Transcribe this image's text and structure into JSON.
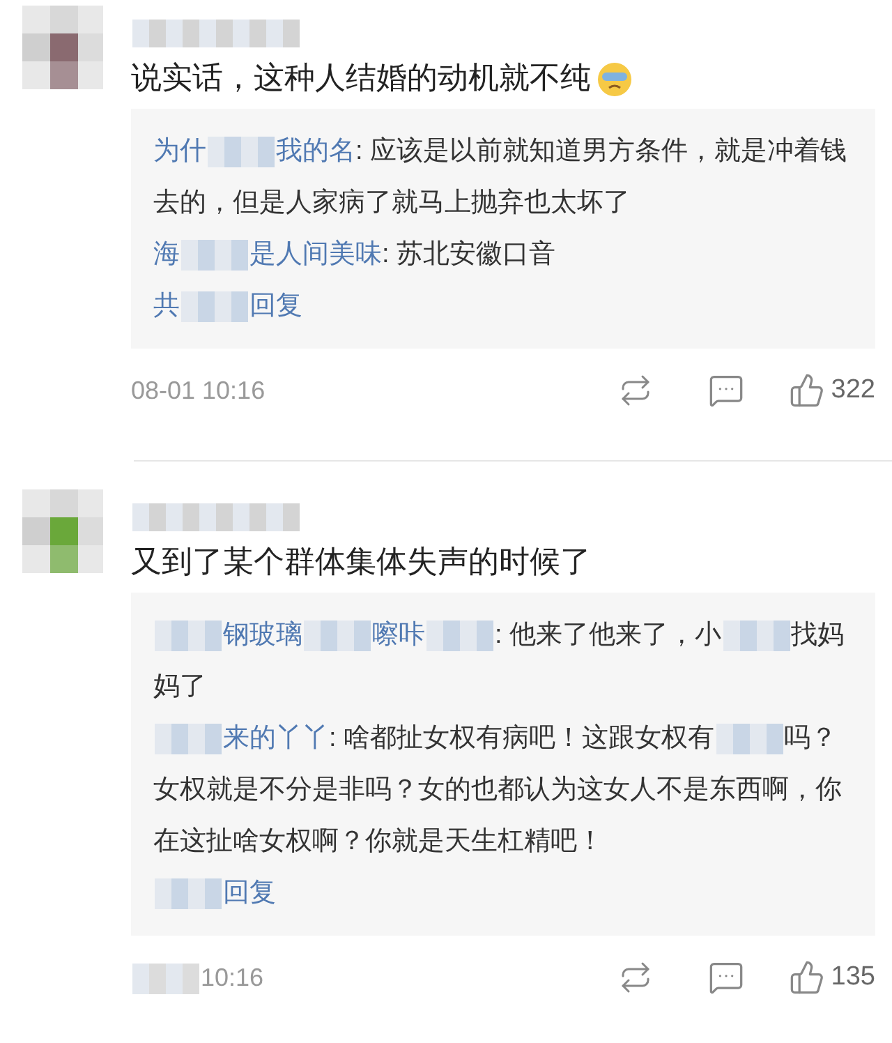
{
  "comments": [
    {
      "text": [
        {
          "kind": "text",
          "text": "说实话，这种人结婚的动机就不纯"
        },
        {
          "kind": "emoji"
        }
      ],
      "replies": [
        {
          "parts": [
            {
              "kind": "name",
              "text": "为什"
            },
            {
              "kind": "mosaic"
            },
            {
              "kind": "name",
              "text": "我的名"
            },
            {
              "kind": "text",
              "text": ": 应该是以前就知道男方条件，就是冲着钱去的，但是人家病了就马上抛弃也太坏了"
            }
          ]
        },
        {
          "parts": [
            {
              "kind": "name",
              "text": "海"
            },
            {
              "kind": "mosaic"
            },
            {
              "kind": "name",
              "text": "是人间美味"
            },
            {
              "kind": "text",
              "text": ": 苏北安徽口音"
            }
          ]
        }
      ],
      "more": [
        {
          "kind": "name",
          "text": "共"
        },
        {
          "kind": "mosaic"
        },
        {
          "kind": "name",
          "text": "回复"
        }
      ],
      "time": [
        {
          "kind": "text",
          "text": "08-01 10:16"
        }
      ],
      "likes": "322"
    },
    {
      "text": [
        {
          "kind": "text",
          "text": "又到了某个群体集体失声的时候了"
        }
      ],
      "replies": [
        {
          "parts": [
            {
              "kind": "mosaic"
            },
            {
              "kind": "name",
              "text": "钢玻璃"
            },
            {
              "kind": "mosaic"
            },
            {
              "kind": "name",
              "text": "嚓咔"
            },
            {
              "kind": "mosaic"
            },
            {
              "kind": "text",
              "text": ": 他来了他来了，小"
            },
            {
              "kind": "mosaic"
            },
            {
              "kind": "text",
              "text": "找妈妈了"
            }
          ]
        },
        {
          "parts": [
            {
              "kind": "mosaic"
            },
            {
              "kind": "name",
              "text": "来的丫丫"
            },
            {
              "kind": "text",
              "text": ": 啥都扯女权有病吧！这跟女权有"
            },
            {
              "kind": "mosaic"
            },
            {
              "kind": "text",
              "text": "吗？女权就是不分是非吗？女的也都认为这女人不是东西啊，你在这扯啥女权啊？你就是天生杠精吧！"
            }
          ]
        }
      ],
      "more": [
        {
          "kind": "mosaic"
        },
        {
          "kind": "name",
          "text": "回复"
        }
      ],
      "time": [
        {
          "kind": "mosaic"
        },
        {
          "kind": "text",
          "text": "10:16"
        }
      ],
      "likes": "135"
    }
  ]
}
